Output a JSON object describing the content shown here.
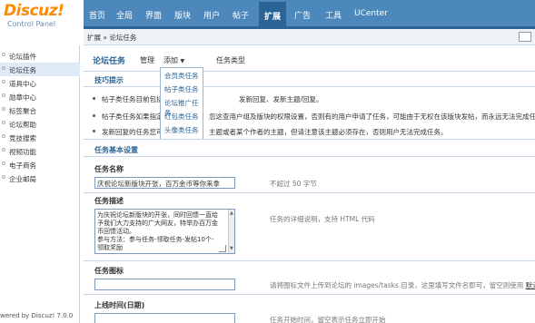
{
  "logo": {
    "main": "Discuz!",
    "sub": "Control Panel"
  },
  "topnav": [
    "首页",
    "全局",
    "界面",
    "版块",
    "用户",
    "帖子",
    "扩展",
    "广告",
    "工具",
    "UCenter"
  ],
  "crumb": "扩展 » 论坛任务",
  "sidebar": {
    "items": [
      "论坛插件",
      "论坛任务",
      "道具中心",
      "勋章中心",
      "标签聚合",
      "论坛帮助",
      "竞技搜索",
      "视频功能",
      "电子商务",
      "企业邮局"
    ],
    "active_index": 1,
    "powered": "wered by Discuz! 7.0.0"
  },
  "main": {
    "title": "论坛任务",
    "tabs": [
      "管理",
      "添加",
      "任务类型"
    ],
    "dropdown": [
      "会员类任务",
      "帖子类任务",
      "论坛推广任务",
      "红包类任务",
      "头像类任务"
    ]
  },
  "tips": {
    "title": "技巧提示",
    "lines": [
      "帖子类任务目前包括",
      "帖子类任务如果指定",
      "发新回复的任务您可"
    ],
    "lines_tail": [
      "发新回复、发新主题/回复。",
      "忽这查用户组及版块的权限设置，否则有的用户申请了任务，可能由于无权在该版块发帖，而永远无法完成任务。",
      "主题或者某个作者的主题，但请注意该主题必须存在，否则用户无法完成任务。"
    ]
  },
  "form": {
    "section": "任务基本设置",
    "name_label": "任务名称",
    "name_value": "庆祝论坛新版块开张，百万金币等你来拿",
    "name_hint": "不超过 50 字节",
    "desc_label": "任务描述",
    "desc_lines": [
      "为庆祝论坛新版块的开张，同时回馈一直给",
      "予我们大力支持的广大网友，特举办百万金",
      "币回馈活动。",
      "参与方法：参与任务-领取任务-发帖10个-",
      "领取奖励"
    ],
    "desc_hint": "任务的详细说明，支持 HTML 代码",
    "icon_label": "任务图标",
    "icon_hint": "请将图标文件上传到论坛的 images/tasks 目录，这里填写文件名即可，留空则使用",
    "icon_hint_link": "默认",
    "time_label": "上线时间(日期)",
    "time_hint": "任务开始时间，留空表示任务立即开始"
  },
  "colors": {
    "nav": "#4c88bb",
    "nav_active": "#2a6496",
    "accent": "#ff8a00",
    "link": "#2a6496"
  }
}
